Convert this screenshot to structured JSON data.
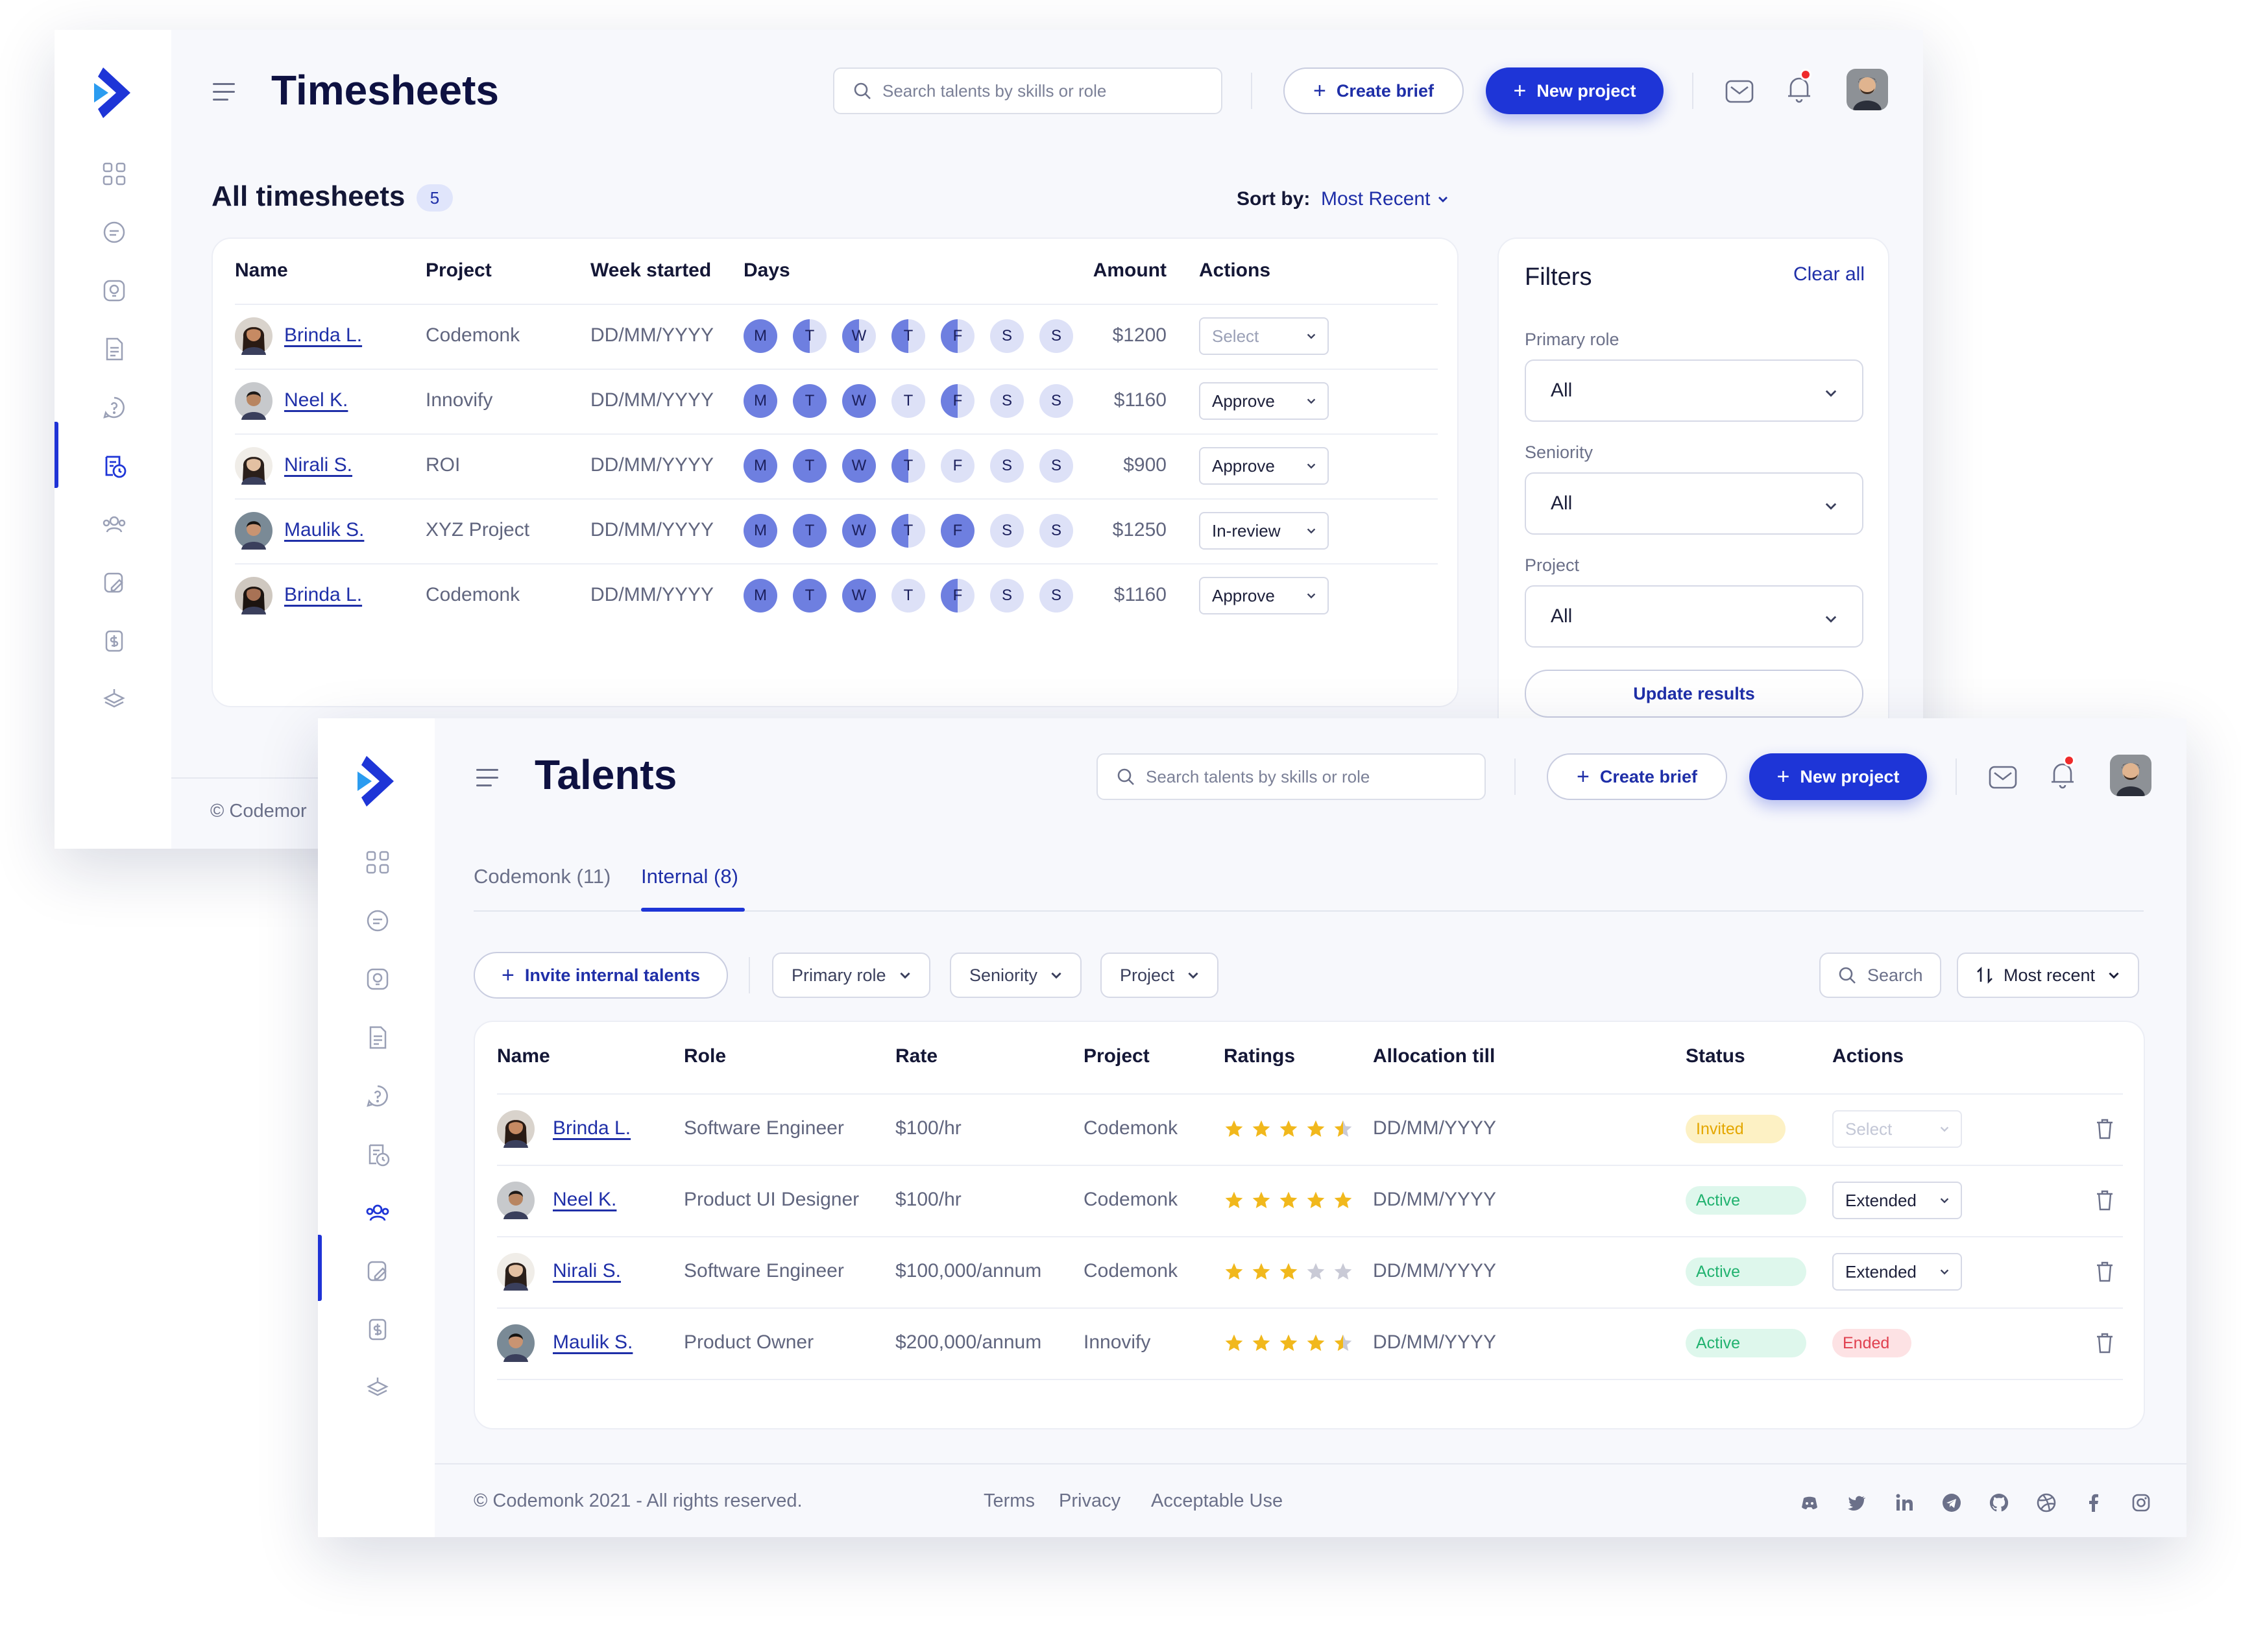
{
  "colors": {
    "accent": "#1e35d7",
    "link": "#1f2fa8",
    "star": "#f1b81c",
    "star_empty": "#c9cad6",
    "day_full": "#6e7fe0",
    "day_empty": "#dde1f7",
    "invited_bg": "#fdf1c4",
    "invited_text": "#e4a700",
    "active_bg": "#def7ec",
    "active_text": "#21b26f",
    "ended_bg": "#fde2e4",
    "ended_text": "#e0404f"
  },
  "timesheets": {
    "title": "Timesheets",
    "search_placeholder": "Search talents by skills or role",
    "create_brief": "Create brief",
    "new_project": "New project",
    "section_title": "All timesheets",
    "count": "5",
    "sort_label": "Sort by:",
    "sort_value": "Most Recent",
    "columns": [
      "Name",
      "Project",
      "Week started",
      "Days",
      "Amount",
      "Actions"
    ],
    "rows": [
      {
        "name": "Brinda L.",
        "project": "Codemonk",
        "week": "DD/MM/YYYY",
        "amount": "$1200",
        "action": "Select",
        "placeholder": true,
        "days": [
          "full",
          "half",
          "half",
          "half",
          "half",
          "empty",
          "empty"
        ]
      },
      {
        "name": "Neel K.",
        "project": "Innovify",
        "week": "DD/MM/YYYY",
        "amount": "$1160",
        "action": "Approve",
        "placeholder": false,
        "days": [
          "full",
          "full",
          "full",
          "empty",
          "half",
          "empty",
          "empty"
        ]
      },
      {
        "name": "Nirali S.",
        "project": "ROI",
        "week": "DD/MM/YYYY",
        "amount": "$900",
        "action": "Approve",
        "placeholder": false,
        "days": [
          "full",
          "full",
          "full",
          "half",
          "empty",
          "empty",
          "empty"
        ]
      },
      {
        "name": "Maulik S.",
        "project": "XYZ Project",
        "week": "DD/MM/YYYY",
        "amount": "$1250",
        "action": "In-review",
        "placeholder": false,
        "days": [
          "full",
          "full",
          "full",
          "half",
          "full",
          "empty",
          "empty"
        ]
      },
      {
        "name": "Brinda L.",
        "project": "Codemonk",
        "week": "DD/MM/YYYY",
        "amount": "$1160",
        "action": "Approve",
        "placeholder": false,
        "days": [
          "full",
          "full",
          "full",
          "empty",
          "half",
          "empty",
          "empty"
        ]
      }
    ],
    "day_letters": [
      "M",
      "T",
      "W",
      "T",
      "F",
      "S",
      "S"
    ],
    "filters": {
      "title": "Filters",
      "clear_all": "Clear all",
      "primary_role_label": "Primary role",
      "primary_role_value": "All",
      "seniority_label": "Seniority",
      "seniority_value": "All",
      "project_label": "Project",
      "project_value": "All",
      "update_button": "Update results"
    },
    "footer_fragment": "© Codemor"
  },
  "talents": {
    "title": "Talents",
    "search_placeholder": "Search talents by skills or role",
    "create_brief": "Create brief",
    "new_project": "New project",
    "tabs": [
      {
        "label": "Codemonk (11)",
        "active": false
      },
      {
        "label": "Internal (8)",
        "active": true
      }
    ],
    "invite_button": "Invite internal talents",
    "filter_primary_role": "Primary role",
    "filter_seniority": "Seniority",
    "filter_project": "Project",
    "search_label": "Search",
    "sort_label": "Most recent",
    "columns": [
      "Name",
      "Role",
      "Rate",
      "Project",
      "Ratings",
      "Allocation till",
      "Status",
      "Actions"
    ],
    "rows": [
      {
        "name": "Brinda L.",
        "role": "Software Engineer",
        "rate": "$100/hr",
        "project": "Codemonk",
        "rating": 4.5,
        "allocation": "DD/MM/YYYY",
        "status": "Invited",
        "action": "Select",
        "action_type": "select-disabled"
      },
      {
        "name": "Neel K.",
        "role": "Product UI Designer",
        "rate": "$100/hr",
        "project": "Codemonk",
        "rating": 5,
        "allocation": "DD/MM/YYYY",
        "status": "Active",
        "action": "Extended",
        "action_type": "select"
      },
      {
        "name": "Nirali S.",
        "role": "Software Engineer",
        "rate": "$100,000/annum",
        "project": "Codemonk",
        "rating": 3,
        "allocation": "DD/MM/YYYY",
        "status": "Active",
        "action": "Extended",
        "action_type": "select"
      },
      {
        "name": "Maulik S.",
        "role": "Product Owner",
        "rate": "$200,000/annum",
        "project": "Innovify",
        "rating": 4.5,
        "allocation": "DD/MM/YYYY",
        "status": "Active",
        "action": "Ended",
        "action_type": "badge"
      }
    ],
    "footer": {
      "copyright": "© Codemonk 2021 - All rights reserved.",
      "links": [
        "Terms",
        "Privacy",
        "Acceptable Use"
      ],
      "social_icons": [
        "discord-icon",
        "twitter-icon",
        "linkedin-icon",
        "telegram-icon",
        "github-icon",
        "dribbble-icon",
        "facebook-icon",
        "instagram-icon"
      ]
    }
  }
}
